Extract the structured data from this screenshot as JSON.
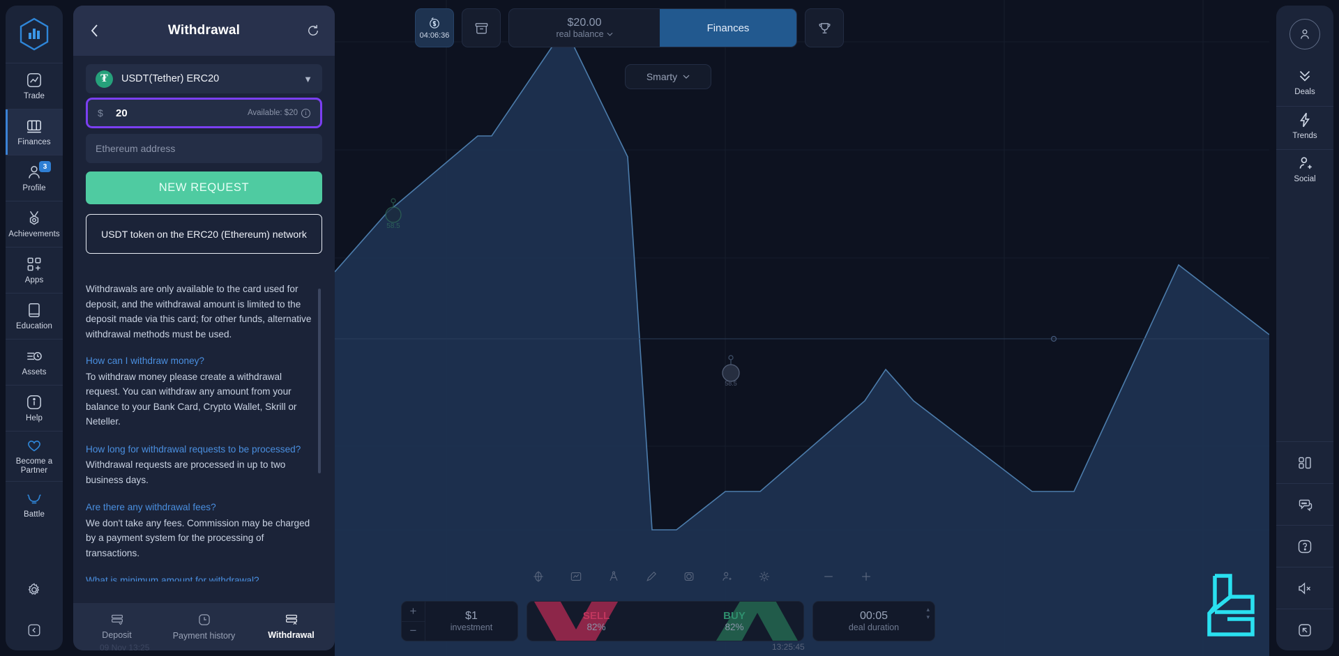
{
  "brand": {
    "name": "platform-logo"
  },
  "sidebar": {
    "items": [
      {
        "label": "Trade",
        "icon": "chart-line-icon",
        "active": false
      },
      {
        "label": "Finances",
        "icon": "wallet-icon",
        "active": true
      },
      {
        "label": "Profile",
        "icon": "user-icon",
        "badge": "3",
        "active": false
      },
      {
        "label": "Achievements",
        "icon": "medal-icon",
        "active": false
      },
      {
        "label": "Apps",
        "icon": "grid-plus-icon",
        "active": false
      },
      {
        "label": "Education",
        "icon": "book-icon",
        "active": false
      },
      {
        "label": "Assets",
        "icon": "assets-clock-icon",
        "active": false
      },
      {
        "label": "Help",
        "icon": "info-circle-icon",
        "active": false
      },
      {
        "label": "Become a Partner",
        "icon": "heart-icon",
        "active": false
      },
      {
        "label": "Battle",
        "icon": "battle-icon",
        "active": false
      }
    ],
    "settings_icon": "gear-icon",
    "collapse_icon": "collapse-left-icon"
  },
  "panel": {
    "back_icon": "back-chevron-icon",
    "title": "Withdrawal",
    "refresh_icon": "refresh-icon",
    "method": {
      "token_symbol": "₮",
      "label": "USDT(Tether) ERC20",
      "chevron": "chevron-down-icon"
    },
    "amount": {
      "currency_symbol": "$",
      "value": "20",
      "available_label": "Available: $20",
      "info_icon": "info-icon"
    },
    "address": {
      "placeholder": "Ethereum address",
      "value": ""
    },
    "submit_label": "NEW REQUEST",
    "network_note": "USDT token on the ERC20 (Ethereum) network",
    "faq": {
      "intro": "Withdrawals are only available to the card used for deposit, and the withdrawal amount is limited to the deposit made via this card; for other funds, alternative withdrawal methods must be used.",
      "items": [
        {
          "q": "How can I withdraw money?",
          "a": "To withdraw money please create a withdrawal request. You can withdraw any amount from your balance to your Bank Card, Crypto Wallet, Skrill or Neteller."
        },
        {
          "q": "How long for withdrawal requests to be processed?",
          "a": "Withdrawal requests are processed in up to two business days."
        },
        {
          "q": "Are there any withdrawal fees?",
          "a": "We don't take any fees. Commission may be charged by a payment system for the processing of transactions."
        },
        {
          "q": "What is minimum amount for withdrawal?",
          "a": ""
        }
      ]
    },
    "tabs": [
      {
        "label": "Deposit",
        "icon": "card-down-icon",
        "active": false
      },
      {
        "label": "Payment history",
        "icon": "clock-icon",
        "active": false
      },
      {
        "label": "Withdrawal",
        "icon": "card-up-icon",
        "active": true
      }
    ]
  },
  "topbar": {
    "timer": {
      "icon": "money-clock-icon",
      "value": "04:06:36"
    },
    "inbox_icon": "archive-icon",
    "balance": {
      "amount": "$20.00",
      "label": "real balance",
      "chevron": "chevron-down-icon"
    },
    "finances_label": "Finances",
    "trophy_icon": "trophy-icon"
  },
  "asset_selector": {
    "label": "Smarty",
    "chevron": "chevron-down-icon"
  },
  "chart_tools": [
    "crosshair-icon",
    "chart-type-icon",
    "compass-icon",
    "pencil-icon",
    "shapes-icon",
    "indicator-icon",
    "settings-grid-icon",
    "zoom-out-icon",
    "zoom-in-icon"
  ],
  "trade": {
    "investment": {
      "amount": "$1",
      "label": "investment",
      "plus": "+",
      "minus": "−"
    },
    "sell": {
      "label": "SELL",
      "percent": "82%",
      "color": "#c0365e"
    },
    "buy": {
      "label": "BUY",
      "percent": "82%",
      "color": "#2f8f6e"
    },
    "duration": {
      "value": "00:05",
      "label": "deal duration",
      "up": "▴",
      "down": "▾"
    }
  },
  "chart_data": {
    "type": "area",
    "title": "",
    "marker_label": "58.5",
    "current_time": "13:25:45",
    "history_time": "09 Nov 13:25",
    "line_color": "#4d7fae",
    "fill_color": "#1e3252",
    "x": [
      0,
      1,
      2,
      3,
      4,
      5,
      6,
      7,
      8,
      9,
      10,
      11,
      12,
      13
    ],
    "y": [
      22,
      48,
      56,
      56,
      80,
      42,
      24,
      18,
      18,
      36,
      60,
      20,
      62,
      62
    ],
    "xlabel": "",
    "ylabel": "",
    "grid": true
  },
  "right_rail": {
    "avatar_icon": "avatar-icon",
    "items": [
      {
        "label": "Deals",
        "icon": "deals-chevrons-icon"
      },
      {
        "label": "Trends",
        "icon": "lightning-icon"
      },
      {
        "label": "Social",
        "icon": "user-plus-icon"
      }
    ],
    "buttons": [
      "layout-icon",
      "chat-icon",
      "question-icon",
      "sound-off-icon",
      "fullscreen-icon"
    ]
  },
  "watermark": {
    "name": "brand-watermark",
    "color": "#2ae0f0"
  }
}
